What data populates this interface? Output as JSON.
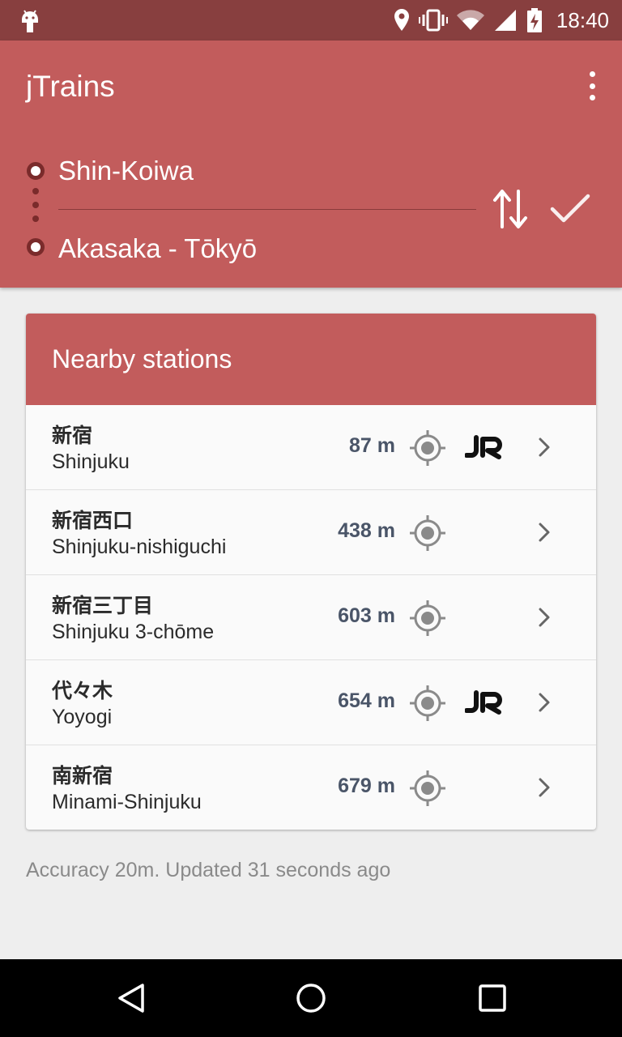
{
  "status_bar": {
    "time": "18:40",
    "icons": [
      "android-icon",
      "location-icon",
      "vibrate-icon",
      "wifi-icon",
      "signal-icon",
      "battery-charging-icon"
    ]
  },
  "app_bar": {
    "title": "jTrains",
    "menu_icon": "overflow-menu-icon"
  },
  "route": {
    "from": "Shin-Koiwa",
    "to": "Akasaka - Tōkyō",
    "swap_icon": "swap-vertical-icon",
    "confirm_icon": "check-icon"
  },
  "nearby": {
    "title": "Nearby stations",
    "stations": [
      {
        "name_jp": "新宿",
        "name_en": "Shinjuku",
        "distance": "87 m",
        "jr": true
      },
      {
        "name_jp": "新宿西口",
        "name_en": "Shinjuku-nishiguchi",
        "distance": "438 m",
        "jr": false
      },
      {
        "name_jp": "新宿三丁目",
        "name_en": "Shinjuku 3-chōme",
        "distance": "603 m",
        "jr": false
      },
      {
        "name_jp": "代々木",
        "name_en": "Yoyogi",
        "distance": "654 m",
        "jr": true
      },
      {
        "name_jp": "南新宿",
        "name_en": "Minami-Shinjuku",
        "distance": "679 m",
        "jr": false
      }
    ]
  },
  "footer": {
    "status": "Accuracy 20m.  Updated 31 seconds ago"
  },
  "colors": {
    "primary": "#c25c5c",
    "primary_dark": "#883f3f",
    "background": "#eeeeee",
    "card": "#fafafa"
  }
}
